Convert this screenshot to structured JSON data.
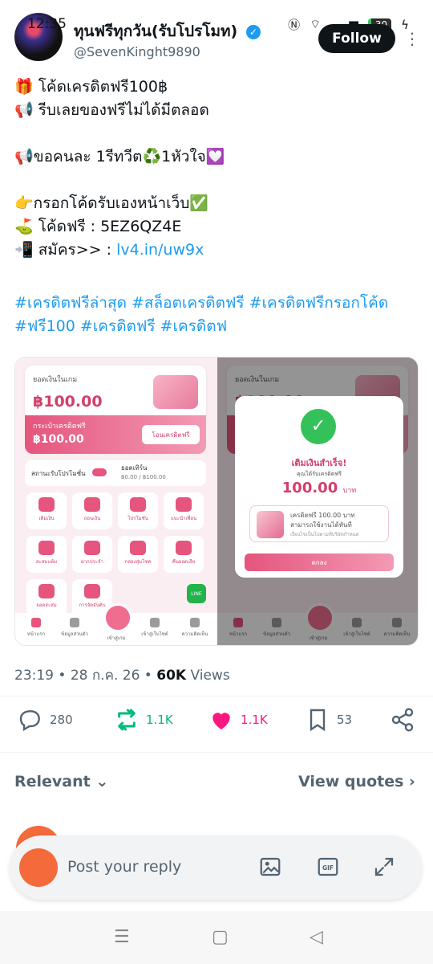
{
  "status_bar": {
    "time": "12:35",
    "battery": "30"
  },
  "header": {
    "display_name": "ทุนฟรีทุกวัน(รับโปรโมท)",
    "verified_mark": "✓",
    "handle": "@SevenKinght9890",
    "follow_label": "Follow",
    "more_label": "⋮"
  },
  "tweet": {
    "lines": [
      "🎁 โค้ดเครดิตฟรี100฿",
      "📢 รีบเลยของฟรีไม่ได้มีตลอด",
      "",
      "📢ขอคนละ 1รีทวีต♻️1หัวใจ💟",
      "",
      "👉กรอกโค้ดรับเองหน้าเว็บ✅",
      "⛳ โค้ดฟรี : 5EZ6QZ4E"
    ],
    "signup_prefix": "📲 สมัคร>> : ",
    "signup_link": "lv4.in/uw9x",
    "hashtags": "#เครดิตฟรีล่าสุด #สล็อตเครดิตฟรี #เครดิตฟรีกรอกโค้ด #ฟรี100 #เครดิตฟรี #เครดิตฟ"
  },
  "media": {
    "balance_label": "ยอดเงินในเกม",
    "balance_amount": "฿100.00",
    "wallet_label": "กระเป๋าเครดิตฟรี",
    "wallet_amount": "฿100.00",
    "transfer_label": "โอนเครดิตฟรี",
    "promo_status_label": "สถานะรับโปรโมชั่น",
    "turnover_label": "ยอดเทิร์น",
    "turnover_value": "฿0.00 / ฿100.00",
    "menu": [
      "เติมเงิน",
      "ถอนเงิน",
      "โปรโมชั่น",
      "แนะนำเพื่อน",
      "สะสมแต้ม",
      "ฝากประจำ",
      "กล่องสุ่มโชค",
      "คืนยอดเสีย",
      "ยอดสะสม",
      "การจัดอันดับ"
    ],
    "line_label": "LINE",
    "nav": [
      "หน้าแรก",
      "ข้อมูลส่วนตัว",
      "เข้าสู่เกม",
      "เข้าสู่เว็บไซต์",
      "ความคิดเห็น"
    ],
    "modal": {
      "title": "เติมเงินสำเร็จ!",
      "subtitle": "คุณได้รับเครดิตฟรี",
      "amount": "100.00",
      "unit": "บาท",
      "gift_line1": "เครดิตฟรี 100.00 บาท",
      "gift_line2": "สามารถใช้งานได้ทันที",
      "gift_line3": "เงื่อนไขเป็นไปตามที่บริษัทกำหนด",
      "ok_label": "ตกลง"
    }
  },
  "meta": {
    "time": "23:19",
    "date": "28 ก.ค. 26",
    "views": "60K",
    "views_label": "Views"
  },
  "actions": {
    "replies": "280",
    "reposts": "1.1K",
    "likes": "1.1K",
    "bookmarks": "53"
  },
  "colors": {
    "repost": "#00ba7c",
    "like": "#f91880",
    "link": "#1d9bf0"
  },
  "sort": {
    "relevant_label": "Relevant",
    "view_quotes_label": "View quotes"
  },
  "composer": {
    "placeholder": "Post your reply"
  }
}
